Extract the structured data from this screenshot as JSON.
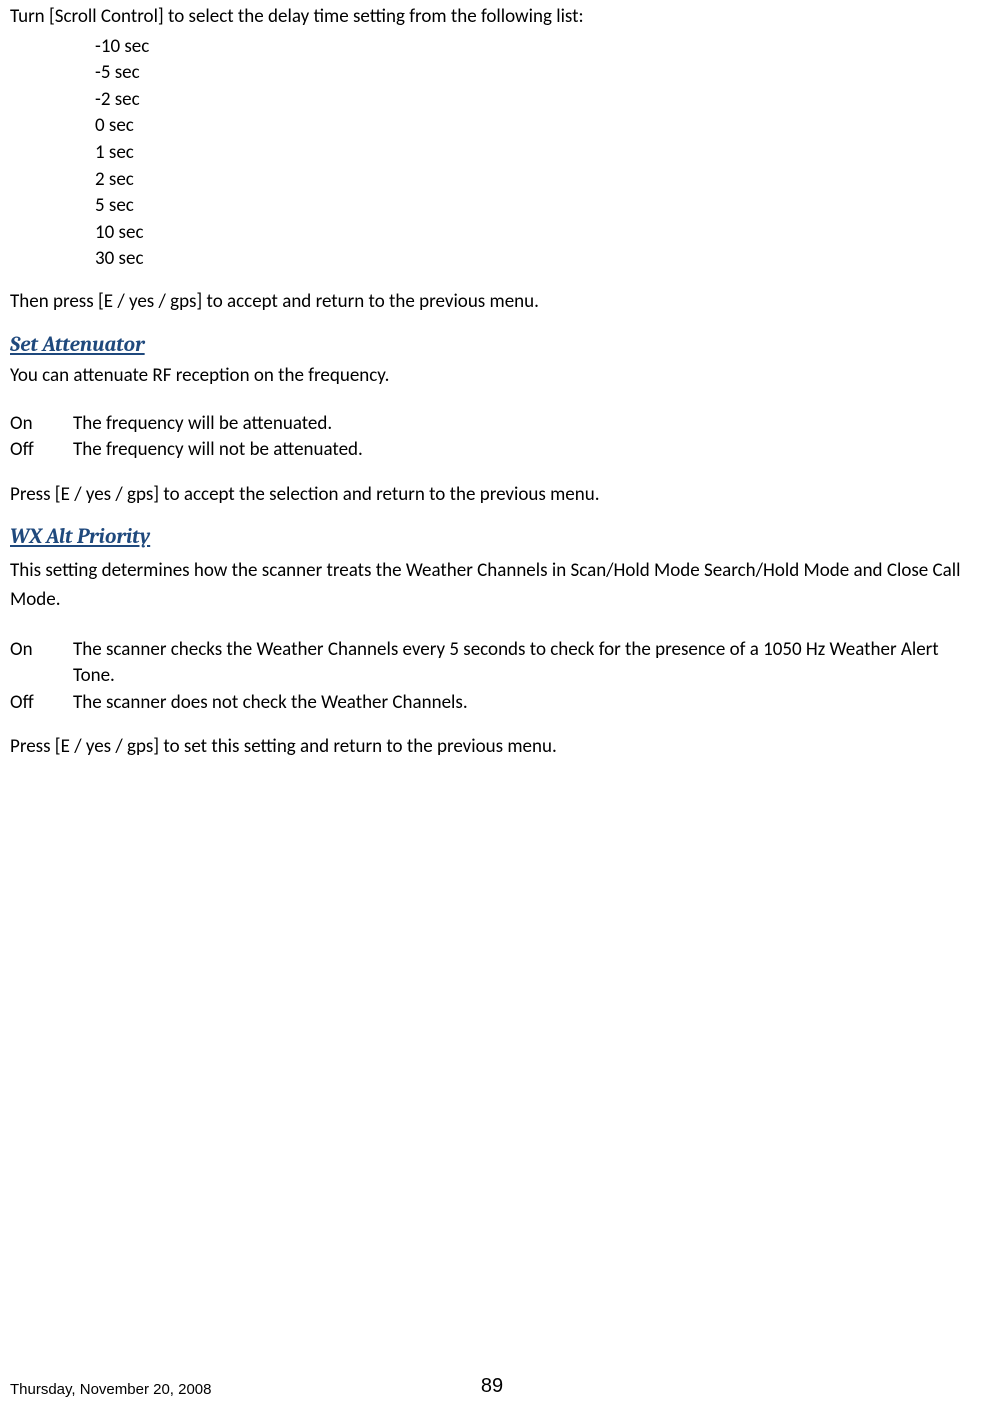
{
  "delay_intro": "Turn [Scroll Control] to select the delay time setting from the following list:",
  "delay_options": [
    "-10 sec",
    "-5 sec",
    "-2 sec",
    "0 sec",
    "1 sec",
    "2 sec",
    "5 sec",
    "10 sec",
    "30 sec"
  ],
  "delay_accept": "Then press [E / yes / gps] to accept and return to the previous menu.",
  "attenuator": {
    "heading": "Set Attenuator",
    "intro": "You can attenuate RF reception on the frequency.",
    "options": [
      {
        "label": "On",
        "desc": "The frequency will be attenuated."
      },
      {
        "label": "Off",
        "desc": "The frequency will not be attenuated."
      }
    ],
    "accept": "Press [E / yes / gps] to accept the selection and return to the previous menu."
  },
  "wx": {
    "heading": "WX Alt Priority",
    "intro": "This setting determines how the scanner treats the Weather Channels in Scan/Hold Mode Search/Hold Mode and Close Call Mode.",
    "options": [
      {
        "label": "On",
        "desc": "The scanner checks the Weather Channels every 5 seconds to check for the presence of a 1050 Hz Weather Alert Tone."
      },
      {
        "label": "Off",
        "desc": "The scanner does not check the Weather Channels."
      }
    ],
    "accept": "Press [E / yes / gps] to set this setting and return to the previous menu."
  },
  "footer": {
    "date": "Thursday, November 20, 2008",
    "page": "89"
  }
}
